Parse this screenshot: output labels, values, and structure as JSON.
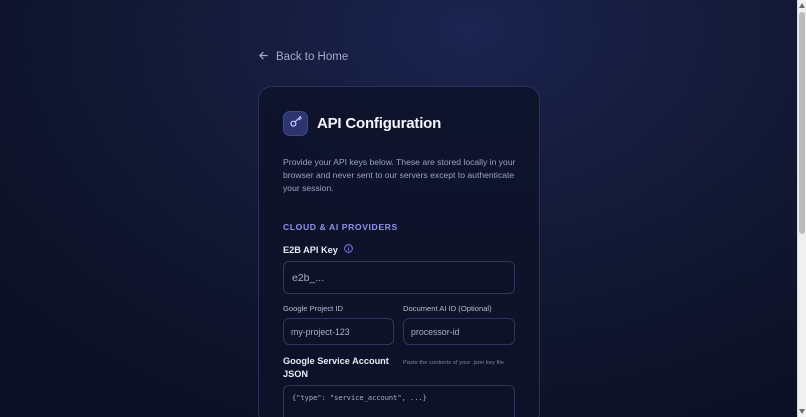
{
  "nav": {
    "back_label": "Back to Home"
  },
  "card": {
    "title": "API Configuration",
    "description": "Provide your API keys below. These are stored locally in your browser and never sent to our servers except to authenticate your session.",
    "section_title": "CLOUD & AI PROVIDERS",
    "fields": {
      "e2b": {
        "label": "E2B API Key",
        "placeholder": "e2b_..."
      },
      "google_project": {
        "label": "Google Project ID",
        "placeholder": "my-project-123"
      },
      "document_ai": {
        "label": "Document AI ID (Optional)",
        "placeholder": "processor-id"
      },
      "service_account": {
        "label": "Google Service Account JSON",
        "hint": "Paste the contents of your .json key file",
        "placeholder": "{\"type\": \"service_account\", ...}"
      }
    }
  },
  "icons": {
    "back": "arrow-left-icon",
    "header": "key-icon",
    "info": "info-icon"
  },
  "colors": {
    "accent": "#8f92f4",
    "card_bg": "#0e1228",
    "icon_bg": "#2d3470"
  }
}
